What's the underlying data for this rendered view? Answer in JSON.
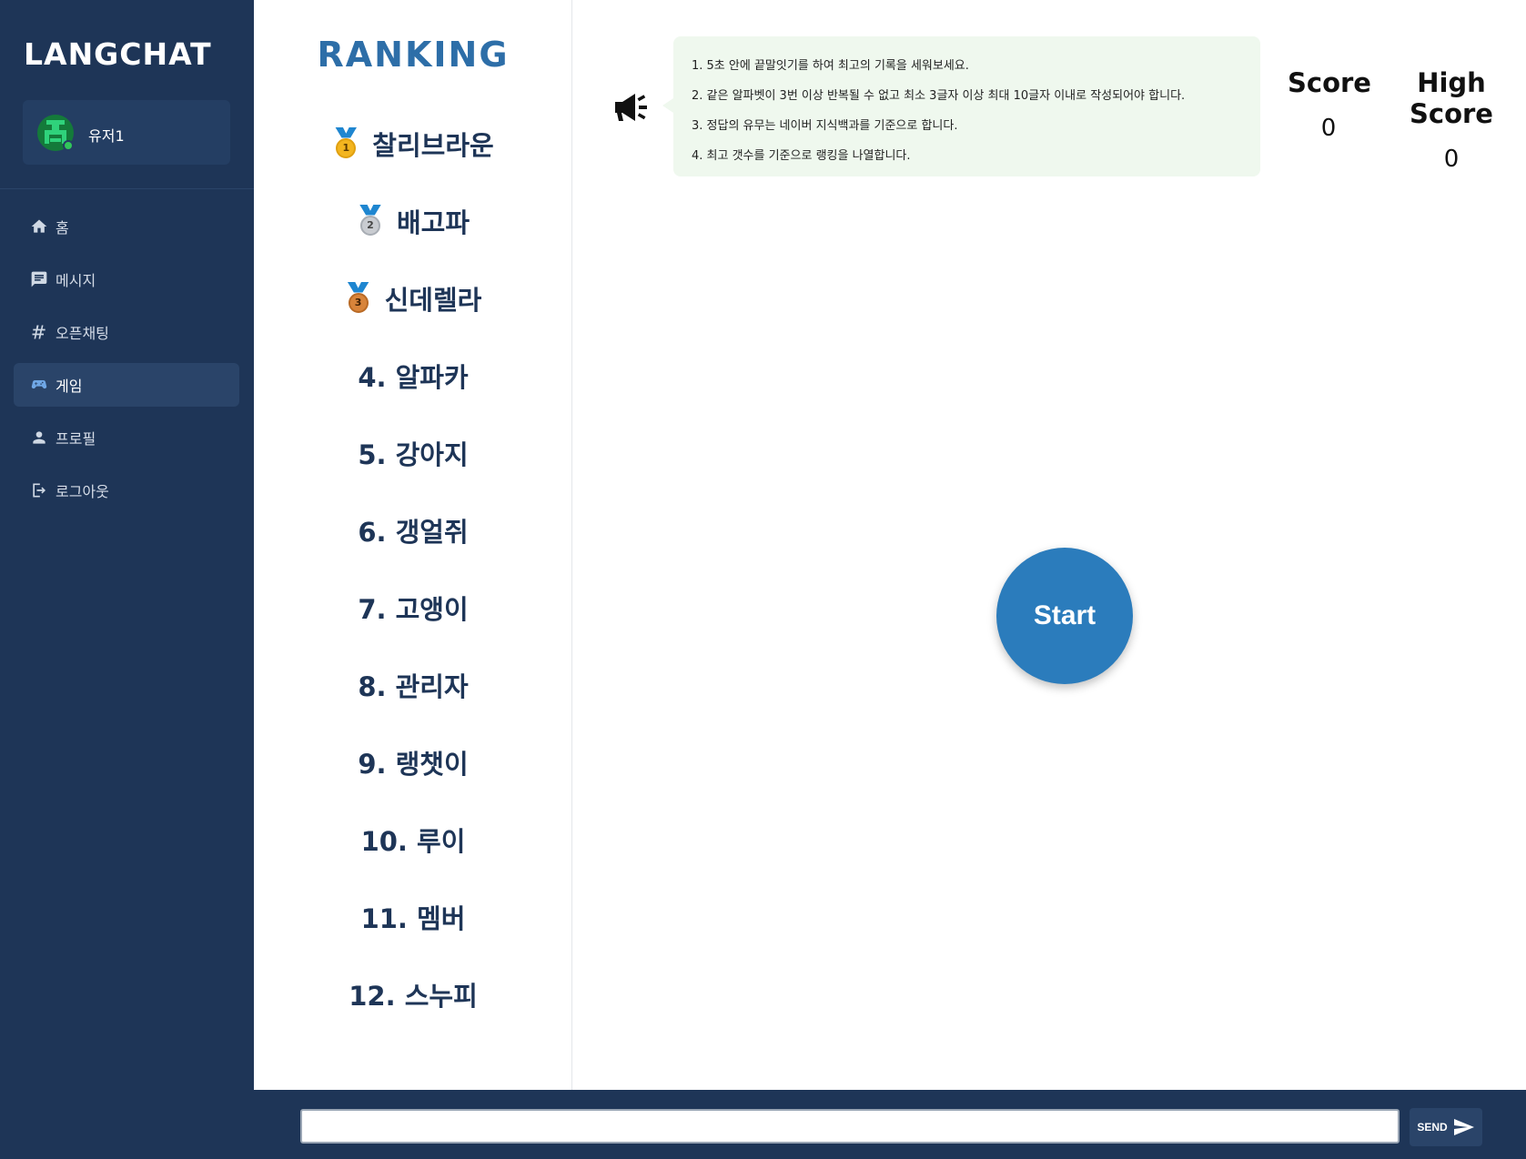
{
  "brand": "LANGCHAT",
  "user": {
    "name": "유저1",
    "status": "online"
  },
  "nav": {
    "items": [
      {
        "label": "홈",
        "icon": "home-icon"
      },
      {
        "label": "메시지",
        "icon": "message-icon"
      },
      {
        "label": "오픈채팅",
        "icon": "hash-icon"
      },
      {
        "label": "게임",
        "icon": "gamepad-icon",
        "active": true
      },
      {
        "label": "프로필",
        "icon": "person-icon"
      },
      {
        "label": "로그아웃",
        "icon": "logout-icon"
      }
    ]
  },
  "ranking": {
    "title": "RANKING",
    "entries": [
      {
        "name": "찰리브라운",
        "medal": "1"
      },
      {
        "name": "배고파",
        "medal": "2"
      },
      {
        "name": "신데렐라",
        "medal": "3"
      },
      {
        "label": "4. 알파카"
      },
      {
        "label": "5. 강아지"
      },
      {
        "label": "6. 갱얼쥐"
      },
      {
        "label": "7. 고앵이"
      },
      {
        "label": "8. 관리자"
      },
      {
        "label": "9. 랭챗이"
      },
      {
        "label": "10. 루이"
      },
      {
        "label": "11. 멤버"
      },
      {
        "label": "12. 스누피"
      }
    ]
  },
  "notice": {
    "rules": [
      "1. 5초 안에 끝말잇기를 하여 최고의 기록을 세워보세요.",
      "2. 같은 알파벳이 3번 이상 반복될 수 없고 최소 3글자 이상 최대 10글자 이내로 작성되어야 합니다.",
      "3. 정답의 유무는 네이버 지식백과를 기준으로 합니다.",
      "4. 최고 갯수를 기준으로 랭킹을 나열합니다."
    ]
  },
  "scores": {
    "score_label": "Score",
    "score_value": "0",
    "high_label": "High Score",
    "high_value": "0"
  },
  "start_label": "Start",
  "chat": {
    "input_value": "",
    "input_placeholder": "",
    "send_label": "SEND"
  },
  "colors": {
    "sidebar": "#1e3557",
    "accent": "#2b7cbc",
    "notice_bg": "#eff8ee",
    "ranking_title": "#2d6ea8"
  }
}
